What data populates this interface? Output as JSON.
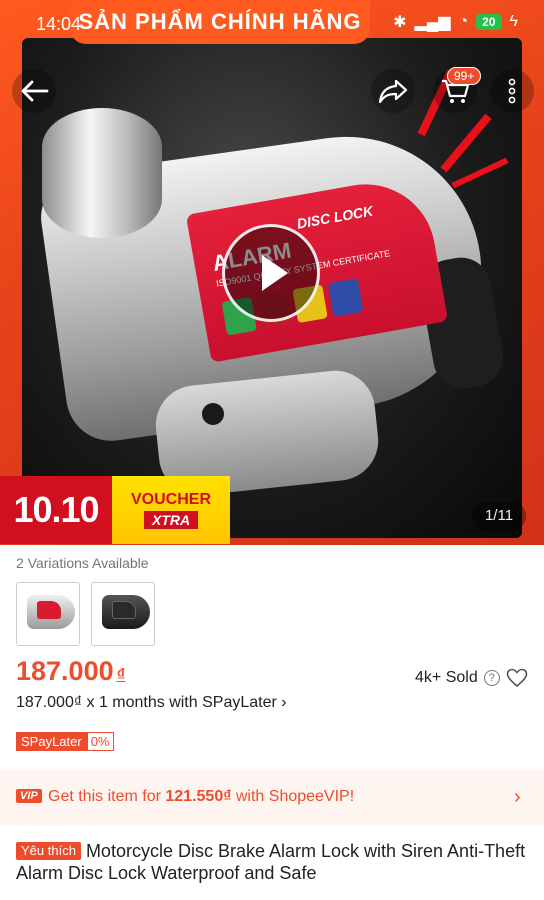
{
  "status_bar": {
    "time": "14:04",
    "battery": "20"
  },
  "hero": {
    "banner": "SẢN PHẨM CHÍNH HÃNG",
    "cart_badge": "99+",
    "image_counter": "1/11",
    "promo": {
      "main": "10.10",
      "voucher_top": "VOUCHER",
      "voucher_bottom": "XTRA"
    },
    "product_label": {
      "alarm": "ALARM",
      "disc_lock": "DISC LOCK",
      "iso": "ISO9001 QUALITY SYSTEM CERTIFICATE"
    }
  },
  "variations": {
    "label": "2 Variations Available"
  },
  "price": {
    "amount": "187.000",
    "currency": "₫"
  },
  "sold": {
    "text": "4k+ Sold"
  },
  "installment": {
    "text": "187.000₫ x 1 months with SPayLater ›"
  },
  "spaylater": {
    "name": "SPayLater",
    "rate": "0%"
  },
  "vip": {
    "badge": "VIP",
    "prefix": "Get this item for ",
    "price": "121.550₫",
    "suffix": " with ShopeeVIP!"
  },
  "product": {
    "tag": "Yêu thích",
    "title": "Motorcycle Disc Brake Alarm Lock with Siren Anti-Theft Alarm Disc Lock Waterproof and Safe"
  },
  "colors": {
    "accent": "#ee4d2d",
    "promo_red": "#d10f1f",
    "promo_yellow": "#ffd400"
  }
}
